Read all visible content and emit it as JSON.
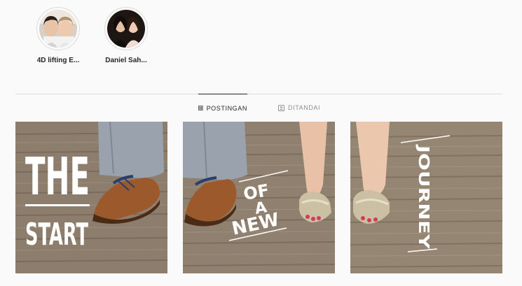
{
  "highlights": [
    {
      "label": "4D lifting E..."
    },
    {
      "label": "Daniel Sah..."
    }
  ],
  "tabs": {
    "posts": "POSTINGAN",
    "tagged": "DITANDAI"
  },
  "posts": [
    {
      "overlay_lines": [
        "THE",
        "START"
      ]
    },
    {
      "overlay_lines": [
        "OF",
        "A",
        "NEW"
      ]
    },
    {
      "overlay_lines": [
        "JOURNEY"
      ]
    }
  ],
  "colors": {
    "active_tab": "#262626",
    "inactive_tab": "#8e8e8e",
    "divider": "#dbdbdb",
    "background": "#fafafa"
  }
}
